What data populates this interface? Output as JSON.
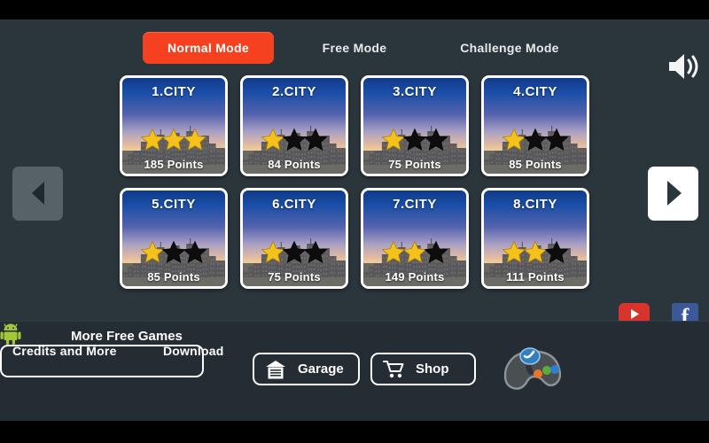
{
  "header": {
    "modes": [
      {
        "label": "Normal Mode",
        "active": true
      },
      {
        "label": "Free Mode",
        "active": false
      },
      {
        "label": "Challenge Mode",
        "active": false
      }
    ],
    "sound_icon": "speaker-on-icon",
    "accent_color": "#f5411f"
  },
  "nav": {
    "prev_icon": "chevron-left-icon",
    "next_icon": "chevron-right-icon",
    "prev_enabled": false,
    "next_enabled": true
  },
  "levels": {
    "star_total": 3,
    "star_filled_color": "#f5c11b",
    "star_empty_color": "#0d0d0d",
    "rows": [
      [
        {
          "title": "1.CITY",
          "points": "185 Points",
          "stars": 3
        },
        {
          "title": "2.CITY",
          "points": "84 Points",
          "stars": 1
        },
        {
          "title": "3.CITY",
          "points": "75 Points",
          "stars": 1
        },
        {
          "title": "4.CITY",
          "points": "85 Points",
          "stars": 1
        }
      ],
      [
        {
          "title": "5.CITY",
          "points": "85 Points",
          "stars": 1
        },
        {
          "title": "6.CITY",
          "points": "75 Points",
          "stars": 1
        },
        {
          "title": "7.CITY",
          "points": "149 Points",
          "stars": 2
        },
        {
          "title": "8.CITY",
          "points": "111 Points",
          "stars": 2
        }
      ]
    ]
  },
  "social": [
    {
      "name": "youtube-button",
      "icon": "youtube-icon",
      "color": "#d8342c",
      "glyph": ""
    },
    {
      "name": "facebook-button",
      "icon": "facebook-icon",
      "color": "#3b5998",
      "glyph": "f"
    }
  ],
  "footer": {
    "credits_label": "Credits and More",
    "android_icon": "android-robot-icon",
    "download_label": "Download",
    "garage_label": "Garage",
    "garage_icon": "garage-icon",
    "shop_label": "Shop",
    "shop_icon": "shopping-cart-icon",
    "more_games_label": "More Free Games",
    "more_games_icon": "gamepad-icon"
  }
}
